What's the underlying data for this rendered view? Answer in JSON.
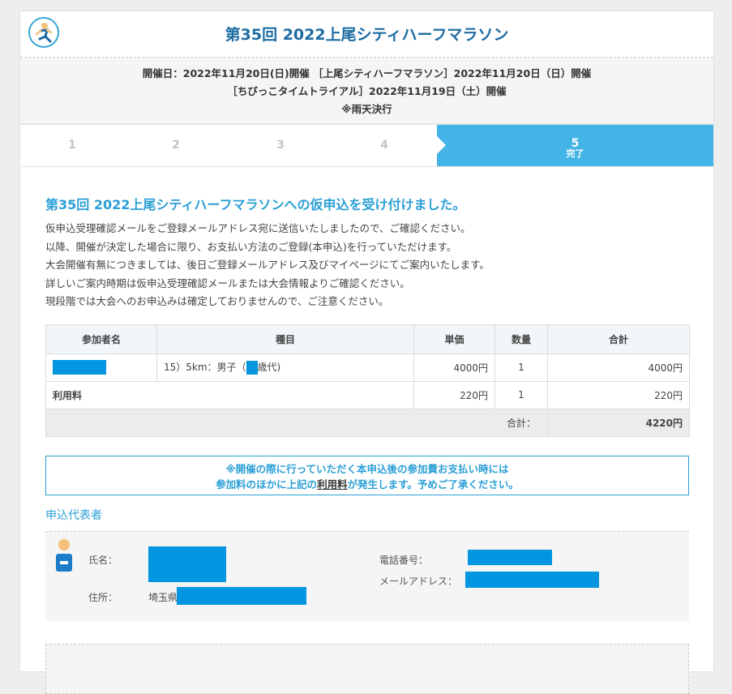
{
  "header": {
    "title": "第35回 2022上尾シティハーフマラソン",
    "logo_icon": "runner-icon"
  },
  "dates": {
    "line1": "開催日：2022年11月20日(日)開催 ［上尾シティハーフマラソン］2022年11月20日（日）開催",
    "line2": "［ちびっこタイムトライアル］2022年11月19日（土）開催",
    "line3": "※雨天決行"
  },
  "steps": {
    "s1": "1",
    "s2": "2",
    "s3": "3",
    "s4": "4",
    "s5": "5",
    "s5_label": "完了"
  },
  "main": {
    "heading": "第35回 2022上尾シティハーフマラソンへの仮申込を受け付けました。",
    "lines": [
      "仮申込受理確認メールをご登録メールアドレス宛に送信いたしましたので、ご確認ください。",
      "以降、開催が決定した場合に限り、お支払い方法のご登録(本申込)を行っていただけます。",
      "大会開催有無につきましては、後日ご登録メールアドレス及びマイページにてご案内いたします。",
      "詳しいご案内時期は仮申込受理確認メールまたは大会情報よりご確認ください。",
      "現段階では大会へのお申込みは確定しておりませんので、ご注意ください。"
    ]
  },
  "table": {
    "headers": [
      "参加者名",
      "種目",
      "単価",
      "数量",
      "合計"
    ],
    "row1": {
      "event_prefix": "15）5km：男子（",
      "event_suffix": "歳代)",
      "price": "4000円",
      "qty": "1",
      "total": "4000円"
    },
    "row2": {
      "name": "利用料",
      "price": "220円",
      "qty": "1",
      "total": "220円"
    },
    "sum_label": "合計：",
    "sum_value": "4220円"
  },
  "notice": {
    "line1": "※開催の際に行っていただく本申込後の参加費お支払い時には",
    "line2_a": "参加料のほかに上記の",
    "line2_link": "利用料",
    "line2_b": "が発生します。予めご了承ください。"
  },
  "representative": {
    "title": "申込代表者",
    "name_label": "氏名：",
    "address_label": "住所：",
    "address_prefix": "埼玉県",
    "phone_label": "電話番号：",
    "email_label": "メールアドレス：",
    "avatar_icon": "person-icon"
  },
  "colors": {
    "accent": "#2a9fd6",
    "step_active": "#44b3e6",
    "redaction": "#0396e0",
    "title": "#1d6ca3"
  }
}
